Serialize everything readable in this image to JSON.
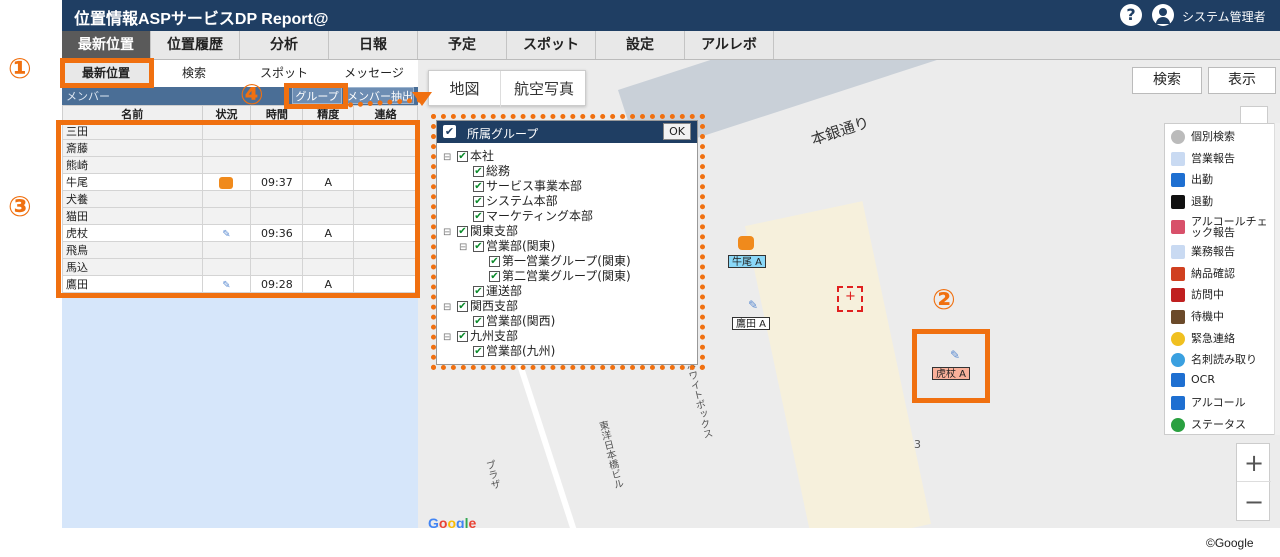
{
  "app": {
    "title": "位置情報ASPサービスDP Report@",
    "help_icon": "?",
    "user": "システム管理者"
  },
  "main_nav": [
    {
      "label": "最新位置",
      "active": true
    },
    {
      "label": "位置履歴"
    },
    {
      "label": "分析"
    },
    {
      "label": "日報"
    },
    {
      "label": "予定"
    },
    {
      "label": "スポット"
    },
    {
      "label": "設定"
    },
    {
      "label": "アルレボ"
    }
  ],
  "sub_tabs": [
    {
      "label": "最新位置",
      "active": true
    },
    {
      "label": "検索"
    },
    {
      "label": "スポット"
    },
    {
      "label": "メッセージ"
    }
  ],
  "member_bar": {
    "label": "メンバー",
    "group_button": "グループ",
    "extract_button": "メンバー抽出"
  },
  "member_table": {
    "headers": [
      "名前",
      "状況",
      "時間",
      "精度",
      "連絡"
    ],
    "rows": [
      {
        "name": "三田",
        "status": "",
        "time": "",
        "accuracy": "",
        "contact": ""
      },
      {
        "name": "斎藤",
        "status": "",
        "time": "",
        "accuracy": "",
        "contact": ""
      },
      {
        "name": "熊崎",
        "status": "",
        "time": "",
        "accuracy": "",
        "contact": ""
      },
      {
        "name": "牛尾",
        "status": "chat-icon",
        "time": "09:37",
        "accuracy": "A",
        "contact": ""
      },
      {
        "name": "犬養",
        "status": "",
        "time": "",
        "accuracy": "",
        "contact": ""
      },
      {
        "name": "猫田",
        "status": "",
        "time": "",
        "accuracy": "",
        "contact": ""
      },
      {
        "name": "虎杖",
        "status": "report-icon",
        "time": "09:36",
        "accuracy": "A",
        "contact": ""
      },
      {
        "name": "飛鳥",
        "status": "",
        "time": "",
        "accuracy": "",
        "contact": ""
      },
      {
        "name": "馬込",
        "status": "",
        "time": "",
        "accuracy": "",
        "contact": ""
      },
      {
        "name": "鷹田",
        "status": "report-icon",
        "time": "09:28",
        "accuracy": "A",
        "contact": ""
      }
    ]
  },
  "map": {
    "type_tabs": [
      "地図",
      "航空写真"
    ],
    "search_button": "検索",
    "show_button": "表示",
    "street_labels": [
      "本銀通り",
      "ホワイトボックス",
      "東洋日本橋ビル",
      "プラザ"
    ],
    "number_label": "3",
    "google_logo": "Google",
    "zoom_in": "+",
    "zoom_out": "−",
    "markers": [
      {
        "name": "牛尾 A",
        "icon": "chat-icon",
        "color": "#8ad8f8"
      },
      {
        "name": "鷹田 A",
        "icon": "report-icon",
        "color": "#ffffff"
      },
      {
        "name": "虎杖 A",
        "icon": "report-icon",
        "color": "#f9b09a"
      }
    ]
  },
  "layers": [
    {
      "label": "個別検索",
      "icon": "person-search-icon",
      "color": "#777777"
    },
    {
      "label": "営業報告",
      "icon": "report-icon",
      "color": "#5b8bd1"
    },
    {
      "label": "出勤",
      "icon": "walk-in-icon",
      "color": "#1e6fd1"
    },
    {
      "label": "退勤",
      "icon": "walk-out-icon",
      "color": "#111111"
    },
    {
      "label": "アルコールチェック報告",
      "icon": "thumb-icon",
      "color": "#d8506a"
    },
    {
      "label": "業務報告",
      "icon": "report-icon",
      "color": "#5b8bd1"
    },
    {
      "label": "納品確認",
      "icon": "truck-icon",
      "color": "#d04020"
    },
    {
      "label": "訪問中",
      "icon": "bottle-icon",
      "color": "#c02020"
    },
    {
      "label": "待機中",
      "icon": "coffee-icon",
      "color": "#6b4a2a"
    },
    {
      "label": "緊急連絡",
      "icon": "alert-icon",
      "color": "#f0c020"
    },
    {
      "label": "名刺読み取り",
      "icon": "pin-icon",
      "color": "#3aa0e0"
    },
    {
      "label": "OCR",
      "icon": "ocr-icon",
      "color": "#1e6fd1"
    },
    {
      "label": "アルコール",
      "icon": "alcohol-icon",
      "color": "#1e6fd1"
    },
    {
      "label": "ステータス",
      "icon": "status-icon",
      "color": "#2aa040"
    }
  ],
  "group_popup": {
    "header_label": "所属グループ",
    "ok_button": "OK",
    "tree": [
      {
        "label": "本社",
        "level": 0,
        "toggle": "⊟"
      },
      {
        "label": "総務",
        "level": 1,
        "toggle": ""
      },
      {
        "label": "サービス事業本部",
        "level": 1,
        "toggle": ""
      },
      {
        "label": "システム本部",
        "level": 1,
        "toggle": ""
      },
      {
        "label": "マーケティング本部",
        "level": 1,
        "toggle": ""
      },
      {
        "label": "関東支部",
        "level": 0,
        "toggle": "⊟"
      },
      {
        "label": "営業部(関東)",
        "level": 1,
        "toggle": "⊟"
      },
      {
        "label": "第一営業グループ(関東)",
        "level": 2,
        "toggle": ""
      },
      {
        "label": "第二営業グループ(関東)",
        "level": 2,
        "toggle": ""
      },
      {
        "label": "運送部",
        "level": 1,
        "toggle": ""
      },
      {
        "label": "関西支部",
        "level": 0,
        "toggle": "⊟"
      },
      {
        "label": "営業部(関西)",
        "level": 1,
        "toggle": ""
      },
      {
        "label": "九州支部",
        "level": 0,
        "toggle": "⊟"
      },
      {
        "label": "営業部(九州)",
        "level": 1,
        "toggle": ""
      }
    ]
  },
  "annotations": [
    "①",
    "②",
    "③",
    "④"
  ],
  "copyright": "©Google"
}
